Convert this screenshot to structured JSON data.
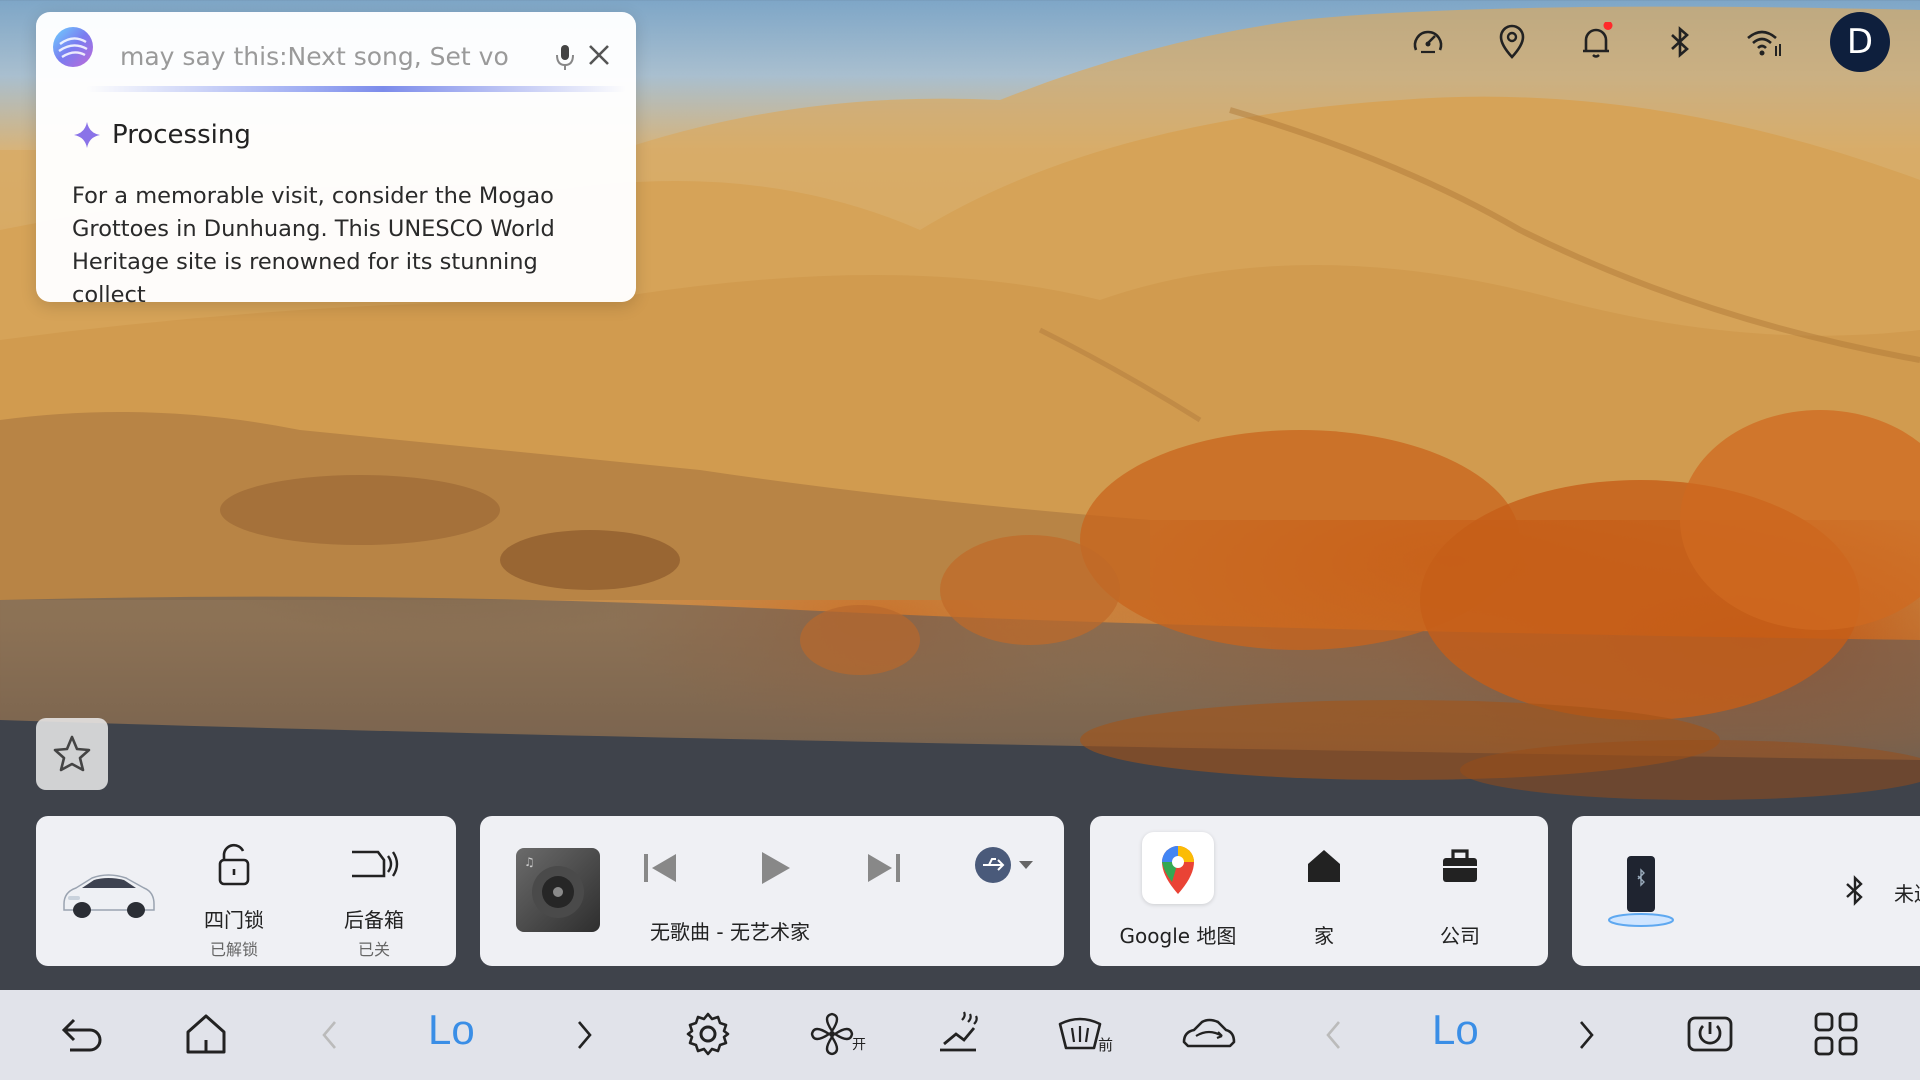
{
  "assistant": {
    "query_text": "may say this:Next song, Set vo",
    "status_label": "Processing",
    "answer_text": "For a memorable visit, consider the Mogao Grottoes in Dunhuang. This UNESCO World Heritage site is renowned for its stunning collect"
  },
  "status_bar": {
    "icons": [
      "speedometer-icon",
      "location-pin-icon",
      "bell-icon",
      "bluetooth-icon",
      "wifi-icon"
    ],
    "notification_dot_color": "#ff2a2a",
    "avatar_letter": "D"
  },
  "vehicle_card": {
    "door_lock_label": "四门锁",
    "door_lock_status": "已解锁",
    "trunk_label": "后备箱",
    "trunk_status": "已关"
  },
  "media_card": {
    "track_text": "无歌曲 - 无艺术家",
    "source_icon": "usb-icon"
  },
  "nav_card": {
    "app_label": "Google 地图",
    "home_label": "家",
    "work_label": "公司"
  },
  "phone_card": {
    "bluetooth_status": "未连"
  },
  "dock": {
    "left_temp": "Lo",
    "right_temp": "Lo",
    "defrost_label": "前",
    "fan_label": "开",
    "accent_color": "#3a8ee6"
  }
}
